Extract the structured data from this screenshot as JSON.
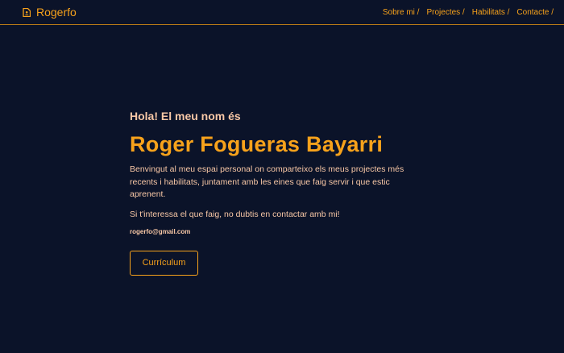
{
  "navbar": {
    "brand": "Rogerfo",
    "brand_icon": "document-icon",
    "links": [
      "Sobre mi /",
      "Projectes /",
      "Habilitats /",
      "Contacte /"
    ]
  },
  "hero": {
    "greeting": "Hola! El meu nom és",
    "name": "Roger Fogueras Bayarri",
    "intro": "Benvingut al meu espai personal on comparteixo els meus projectes més recents i habilitats, juntament amb les eines que faig servir i que estic aprenent.",
    "cta": "Si t'interessa el que faig, no dubtis en contactar amb mi!",
    "email": "rogerfo@gmail.com",
    "cv_button": "Currículum"
  },
  "colors": {
    "background": "#0b1329",
    "accent": "#f7a21b",
    "text": "#f9c8a6"
  }
}
